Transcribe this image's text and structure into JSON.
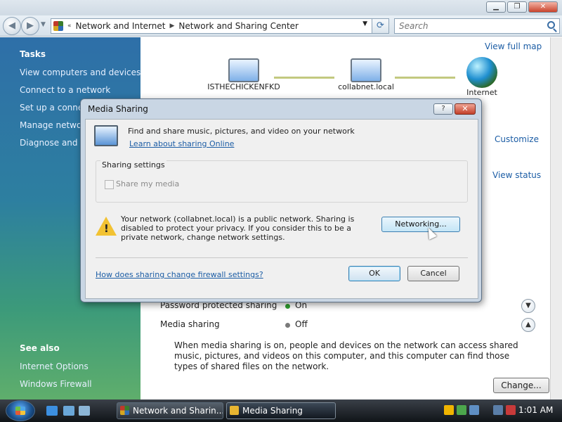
{
  "window": {
    "controls": {
      "minimize": "▁",
      "maximize": "❐",
      "close": "✕"
    }
  },
  "nav": {
    "back_icon": "back-arrow-icon",
    "forward_icon": "forward-arrow-icon",
    "breadcrumb": [
      "Network and Internet",
      "Network and Sharing Center"
    ],
    "search_placeholder": "Search"
  },
  "sidebar": {
    "tasks_heading": "Tasks",
    "tasks": [
      "View computers and devices",
      "Connect to a network",
      "Set up a connection or network",
      "Manage network connections",
      "Diagnose and repair"
    ],
    "see_also_heading": "See also",
    "see_also": [
      "Internet Options",
      "Windows Firewall"
    ]
  },
  "content": {
    "view_full_map": "View full map",
    "map_nodes": [
      "ISTHECHICKENFKD",
      "collabnet.local",
      "Internet"
    ],
    "customize": "Customize",
    "view_status": "View status",
    "sharing_rows": [
      {
        "label": "Password protected sharing",
        "value": "On",
        "status_color": "#2f9e2f"
      },
      {
        "label": "Media sharing",
        "value": "Off",
        "status_color": "#7a7a7a"
      }
    ],
    "media_description": "When media sharing is on, people and devices on the network can access shared music, pictures, and videos on this computer, and this computer can find those types of shared files on the network.",
    "change_button": "Change..."
  },
  "dialog": {
    "title": "Media Sharing",
    "help": "?",
    "close": "✕",
    "intro_text": "Find and share music, pictures, and video on your network",
    "learn_link": "Learn about sharing Online",
    "group_label": "Sharing settings",
    "checkbox_label": "Share my media",
    "warning_text": "Your network (collabnet.local) is a public network. Sharing is disabled to protect your privacy. If you consider this to be a private network, change network settings.",
    "networking_button": "Networking...",
    "firewall_link": "How does sharing change firewall settings?",
    "ok_button": "OK",
    "cancel_button": "Cancel"
  },
  "taskbar": {
    "tasks": [
      "Network and Sharin...",
      "Media Sharing"
    ],
    "clock": "1:01 AM"
  },
  "colors": {
    "link": "#1c5da5",
    "sidebar_top": "#2e6fa8",
    "sidebar_bottom": "#5fae6c"
  }
}
